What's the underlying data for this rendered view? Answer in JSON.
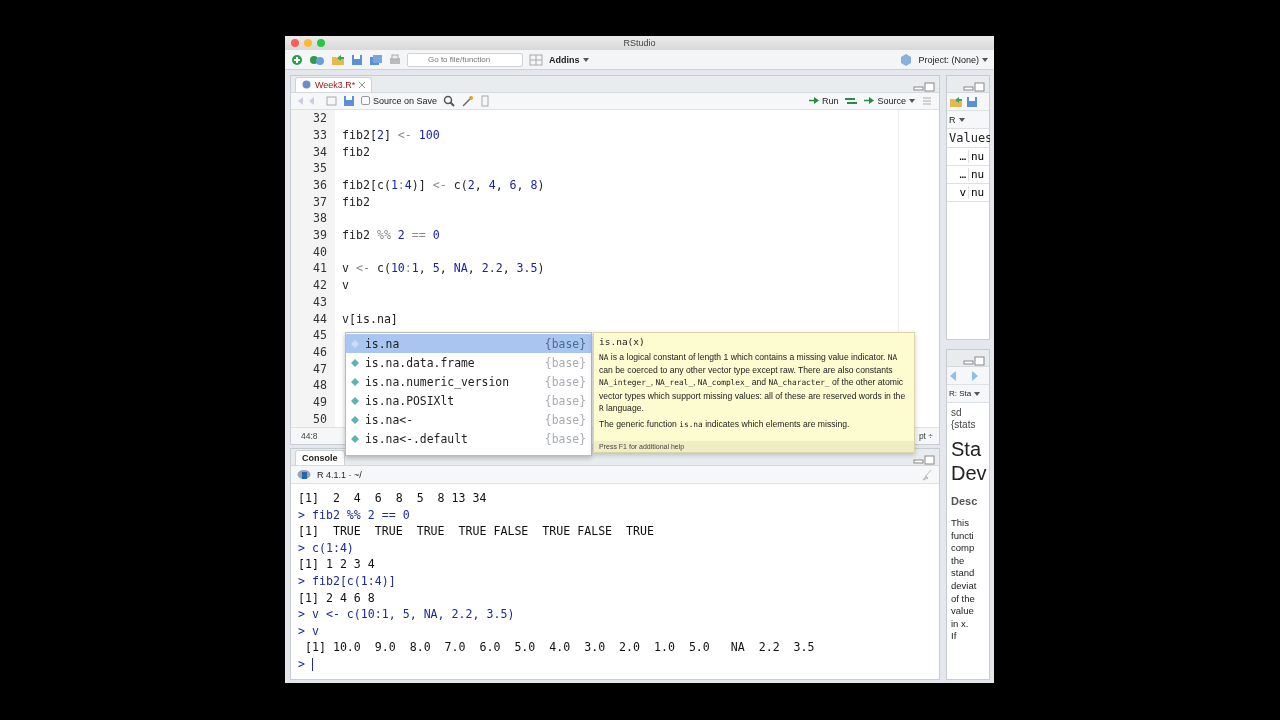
{
  "window": {
    "title": "RStudio"
  },
  "toolbar": {
    "goto_placeholder": "Go to file/function",
    "addins": "Addins",
    "project": "Project: (None)"
  },
  "editor": {
    "tab": {
      "label": "Week3.R*",
      "modified": true,
      "selected": true
    },
    "source_on_save": {
      "label": "Source on Save",
      "checked": false
    },
    "run": "Run",
    "source": "Source",
    "lines": [
      {
        "n": "32"
      },
      {
        "n": "33",
        "tokens": [
          {
            "text": "fib2[",
            "kind": "plain"
          },
          {
            "text": "2",
            "kind": "number"
          },
          {
            "text": "]",
            "kind": "plain"
          },
          {
            "text": " <- ",
            "kind": "operator"
          },
          {
            "text": "100",
            "kind": "number"
          }
        ]
      },
      {
        "n": "34",
        "tokens": [
          {
            "text": "fib2",
            "kind": "plain"
          }
        ]
      },
      {
        "n": "35"
      },
      {
        "n": "36",
        "tokens": [
          {
            "text": "fib2[c(",
            "kind": "plain"
          },
          {
            "text": "1",
            "kind": "number"
          },
          {
            "text": ":",
            "kind": "operator"
          },
          {
            "text": "4",
            "kind": "number"
          },
          {
            "text": ")]",
            "kind": "plain"
          },
          {
            "text": " <- ",
            "kind": "operator"
          },
          {
            "text": "c(",
            "kind": "plain"
          },
          {
            "text": "2",
            "kind": "number"
          },
          {
            "text": ", ",
            "kind": "plain"
          },
          {
            "text": "4",
            "kind": "number"
          },
          {
            "text": ", ",
            "kind": "plain"
          },
          {
            "text": "6",
            "kind": "number"
          },
          {
            "text": ", ",
            "kind": "plain"
          },
          {
            "text": "8",
            "kind": "number"
          },
          {
            "text": ")",
            "kind": "plain"
          }
        ]
      },
      {
        "n": "37",
        "tokens": [
          {
            "text": "fib2",
            "kind": "plain"
          }
        ]
      },
      {
        "n": "38"
      },
      {
        "n": "39",
        "tokens": [
          {
            "text": "fib2 ",
            "kind": "plain"
          },
          {
            "text": "%%",
            "kind": "operator"
          },
          {
            "text": " 2",
            "kind": "number"
          },
          {
            "text": " == ",
            "kind": "operator"
          },
          {
            "text": "0",
            "kind": "number"
          }
        ]
      },
      {
        "n": "40"
      },
      {
        "n": "41",
        "tokens": [
          {
            "text": "v",
            "kind": "plain"
          },
          {
            "text": " <- ",
            "kind": "operator"
          },
          {
            "text": "c(",
            "kind": "plain"
          },
          {
            "text": "10",
            "kind": "number"
          },
          {
            "text": ":",
            "kind": "operator"
          },
          {
            "text": "1",
            "kind": "number"
          },
          {
            "text": ", ",
            "kind": "plain"
          },
          {
            "text": "5",
            "kind": "number"
          },
          {
            "text": ", ",
            "kind": "plain"
          },
          {
            "text": "NA",
            "kind": "number"
          },
          {
            "text": ", ",
            "kind": "plain"
          },
          {
            "text": "2.2",
            "kind": "number"
          },
          {
            "text": ", ",
            "kind": "plain"
          },
          {
            "text": "3.5",
            "kind": "number"
          },
          {
            "text": ")",
            "kind": "plain"
          }
        ]
      },
      {
        "n": "42",
        "tokens": [
          {
            "text": "v",
            "kind": "plain"
          }
        ]
      },
      {
        "n": "43"
      },
      {
        "n": "44",
        "tokens": [
          {
            "text": "v[is.na]",
            "kind": "plain"
          }
        ]
      },
      {
        "n": "45"
      },
      {
        "n": "46"
      },
      {
        "n": "47"
      },
      {
        "n": "48"
      },
      {
        "n": "49"
      },
      {
        "n": "50"
      }
    ],
    "position": "44:8",
    "file_type": "pt ÷"
  },
  "autocomplete": [
    {
      "name": "is.na",
      "package": "{base}",
      "selected": true
    },
    {
      "name": "is.na.data.frame",
      "package": "{base}",
      "selected": false
    },
    {
      "name": "is.na.numeric_version",
      "package": "{base}",
      "selected": false
    },
    {
      "name": "is.na.POSIXlt",
      "package": "{base}",
      "selected": false
    },
    {
      "name": "is.na<-",
      "package": "{base}",
      "selected": false
    },
    {
      "name": "is.na<-.default",
      "package": "{base}",
      "selected": false
    }
  ],
  "help_tooltip": {
    "signature": "is.na(x)",
    "paragraphs": [
      [
        {
          "text": "NA",
          "kind": "code"
        },
        {
          "text": " is a logical constant of length 1 which contains a missing value indicator. ",
          "kind": "text"
        },
        {
          "text": "NA",
          "kind": "code"
        },
        {
          "text": " can be coerced to any other vector type except raw. There are also constants ",
          "kind": "text"
        },
        {
          "text": "NA_integer_",
          "kind": "code"
        },
        {
          "text": ", ",
          "kind": "text"
        },
        {
          "text": "NA_real_",
          "kind": "code"
        },
        {
          "text": ", ",
          "kind": "text"
        },
        {
          "text": "NA_complex_",
          "kind": "code"
        },
        {
          "text": " and ",
          "kind": "text"
        },
        {
          "text": "NA_character_",
          "kind": "code"
        },
        {
          "text": " of the other atomic vector types which support missing values: all of these are reserved words in the ",
          "kind": "text"
        },
        {
          "text": "R",
          "kind": "code"
        },
        {
          "text": " language.",
          "kind": "text"
        }
      ],
      [
        {
          "text": "The generic function ",
          "kind": "text"
        },
        {
          "text": "is.na",
          "kind": "code"
        },
        {
          "text": " indicates which elements are missing.",
          "kind": "text"
        }
      ]
    ],
    "footer": "Press F1 for additional help"
  },
  "console": {
    "tab": "Console",
    "version": "R 4.1.1 · ~/",
    "lines": [
      {
        "kind": "output",
        "text": "[1]  2  4  6  8  5  8 13 34"
      },
      {
        "kind": "input",
        "text": "> fib2 %% 2 == 0"
      },
      {
        "kind": "output",
        "text": "[1]  TRUE  TRUE  TRUE  TRUE FALSE  TRUE FALSE  TRUE"
      },
      {
        "kind": "input",
        "text": "> c(1:4)"
      },
      {
        "kind": "output",
        "text": "[1] 1 2 3 4"
      },
      {
        "kind": "input",
        "text": "> fib2[c(1:4)]"
      },
      {
        "kind": "output",
        "text": "[1] 2 4 6 8"
      },
      {
        "kind": "input",
        "text": "> v <- c(10:1, 5, NA, 2.2, 3.5)"
      },
      {
        "kind": "input",
        "text": "> v"
      },
      {
        "kind": "output",
        "text": " [1] 10.0  9.0  8.0  7.0  6.0  5.0  4.0  3.0  2.0  1.0  5.0   NA  2.2  3.5"
      },
      {
        "kind": "prompt",
        "text": ">"
      }
    ]
  },
  "environment": {
    "dropdown": "R",
    "header": "Values",
    "rows": [
      [
        "…",
        "nu"
      ],
      [
        "…",
        "nu"
      ],
      [
        "v",
        "nu"
      ]
    ]
  },
  "help": {
    "dropdown": "R: Sta",
    "topic": [
      "sd",
      "{stats"
    ],
    "title": [
      "Sta",
      "Dev"
    ],
    "section": "Desc",
    "body": [
      "This",
      "functi",
      "comp",
      "the",
      "stand",
      "deviat",
      "of the",
      "value",
      "in x.",
      "If"
    ]
  }
}
